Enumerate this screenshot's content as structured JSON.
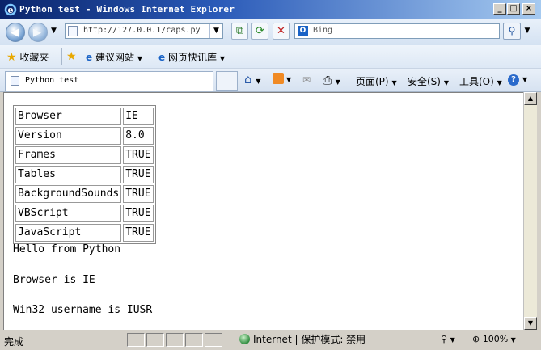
{
  "window": {
    "title": "Python test - Windows Internet Explorer"
  },
  "address": {
    "url": "http://127.0.0.1/caps.py"
  },
  "search": {
    "placeholder": "Bing",
    "provider_logo": "O"
  },
  "favorites": {
    "label": "收藏夹",
    "suggested_sites": "建议网站",
    "web_slice": "网页快讯库"
  },
  "tab": {
    "title": "Python test"
  },
  "commands": {
    "page": "页面(P)",
    "safety": "安全(S)",
    "tools": "工具(O)"
  },
  "caps_table": [
    {
      "name": "Browser",
      "value": "IE"
    },
    {
      "name": "Version",
      "value": "8.0"
    },
    {
      "name": "Frames",
      "value": "TRUE"
    },
    {
      "name": "Tables",
      "value": "TRUE"
    },
    {
      "name": "BackgroundSounds",
      "value": "TRUE"
    },
    {
      "name": "VBScript",
      "value": "TRUE"
    },
    {
      "name": "JavaScript",
      "value": "TRUE"
    }
  ],
  "body_lines": {
    "hello": "Hello from Python",
    "browser": "Browser is IE",
    "username": "Win32 username is IUSR"
  },
  "status": {
    "text": "完成",
    "zone": "Internet | 保护模式: 禁用",
    "zoom": "100%"
  }
}
